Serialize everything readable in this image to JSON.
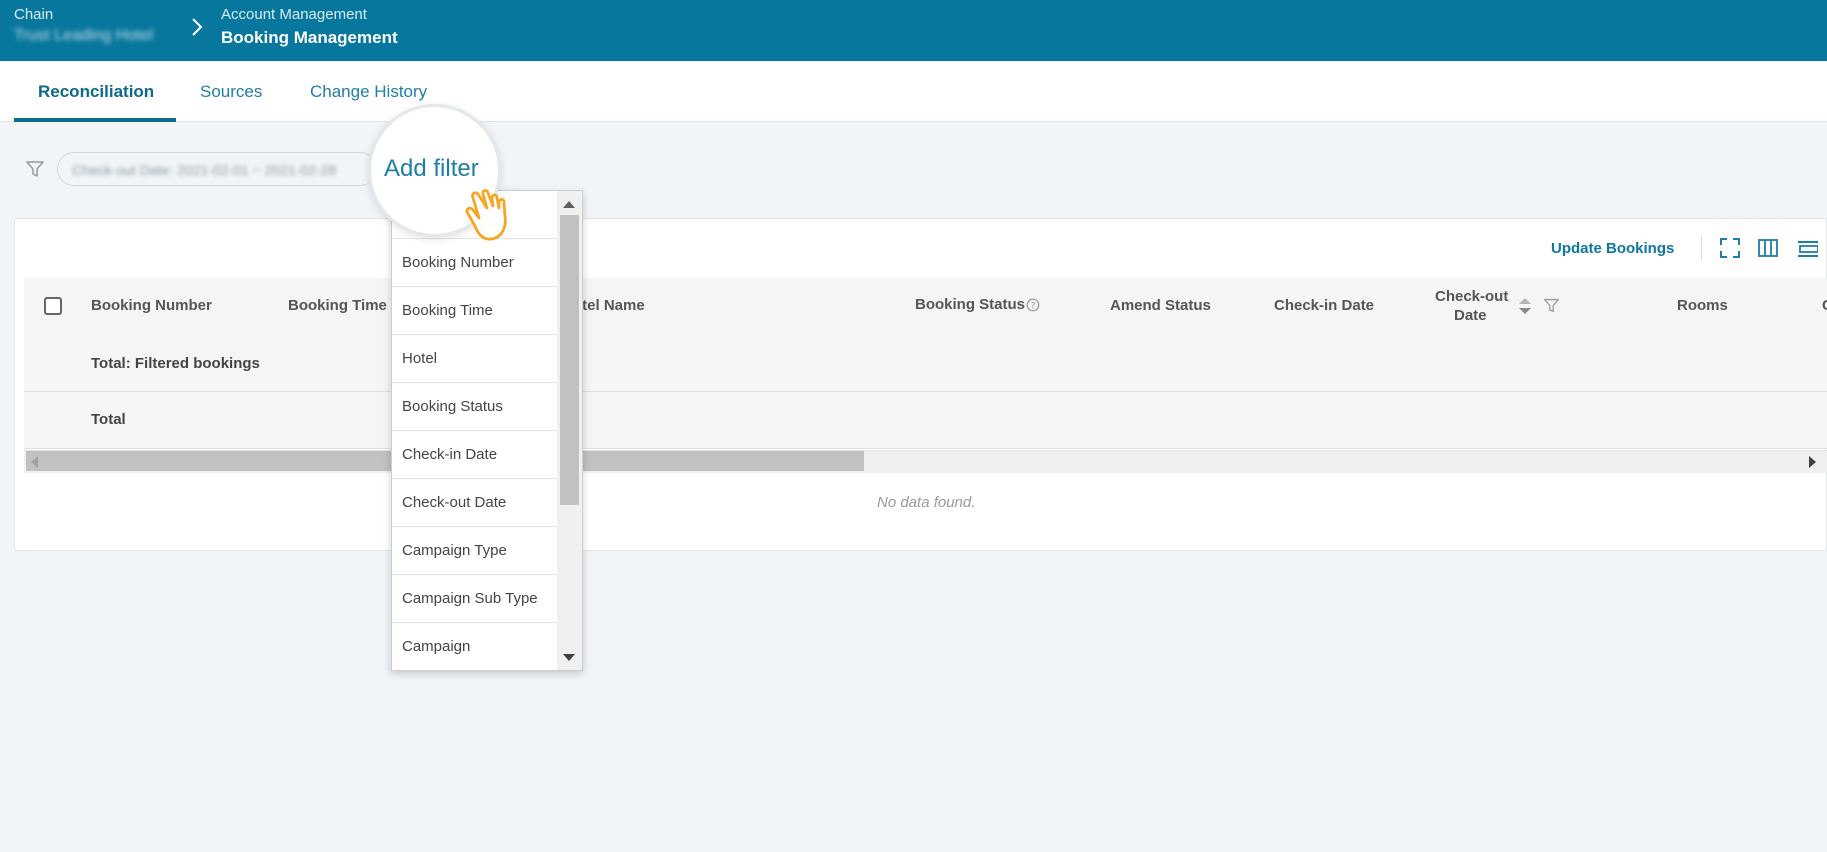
{
  "header": {
    "level1_label": "Chain",
    "level1_value": "Trust Leading Hotel",
    "level2_label": "Account Management",
    "level2_value": "Booking Management"
  },
  "tabs": [
    {
      "label": "Reconciliation",
      "active": true
    },
    {
      "label": "Sources",
      "active": false
    },
    {
      "label": "Change History",
      "active": false
    }
  ],
  "filters": {
    "active_chip": "Check-out Date: 2021-02-01 ~ 2021-02-28",
    "add_filter_label": "Add filter",
    "options": [
      "Booking Number",
      "Booking Time",
      "Hotel",
      "Booking Status",
      "Check-in Date",
      "Check-out Date",
      "Campaign Type",
      "Campaign Sub Type",
      "Campaign"
    ]
  },
  "toolbar": {
    "update_label": "Update Bookings",
    "icons": [
      "fullscreen-icon",
      "columns-icon",
      "density-icon"
    ]
  },
  "table": {
    "columns": [
      "Booking Number",
      "Booking Time",
      "otel Name",
      "Booking Status",
      "Amend Status",
      "Check-in Date",
      "Check-out",
      "Date",
      "Rooms",
      "C"
    ],
    "rows": [
      "Total: Filtered bookings",
      "Total"
    ],
    "empty_text": "No data found."
  },
  "colors": {
    "header_bg": "#08779e",
    "accent": "#0e6a8c",
    "hand": "#f5a623"
  }
}
